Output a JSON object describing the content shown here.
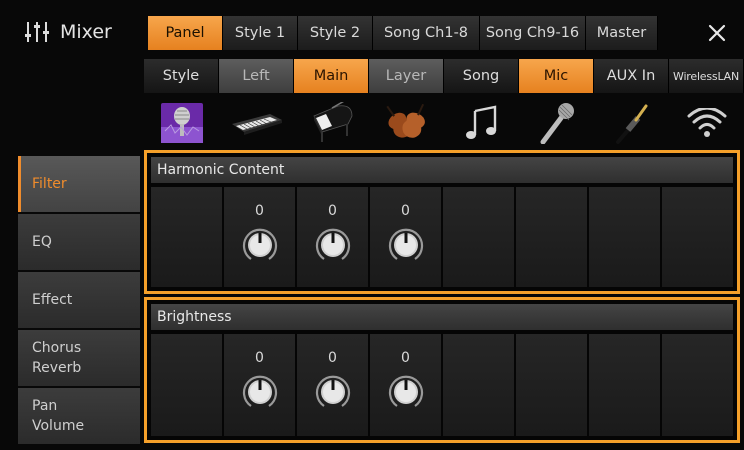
{
  "header": {
    "title": "Mixer",
    "tabs": [
      "Panel",
      "Style 1",
      "Style 2",
      "Song Ch1-8",
      "Song Ch9-16",
      "Master"
    ],
    "active_tab": "Panel",
    "close_icon": "close-icon"
  },
  "parts": [
    {
      "label": "Style",
      "state": "normal",
      "icon": "microphone-stage-icon"
    },
    {
      "label": "Left",
      "state": "inactive",
      "icon": "keyboard-icon"
    },
    {
      "label": "Main",
      "state": "selected",
      "icon": "grand-piano-icon"
    },
    {
      "label": "Layer",
      "state": "inactive",
      "icon": "violins-icon"
    },
    {
      "label": "Song",
      "state": "normal",
      "icon": "music-note-icon"
    },
    {
      "label": "Mic",
      "state": "selected",
      "icon": "microphone-icon"
    },
    {
      "label": "AUX In",
      "state": "normal",
      "icon": "audio-plug-icon"
    },
    {
      "label": "WirelessLAN",
      "state": "normal",
      "icon": "wifi-icon"
    }
  ],
  "side_menu": [
    {
      "label": "Filter",
      "active": true
    },
    {
      "label": "EQ",
      "active": false
    },
    {
      "label": "Effect",
      "active": false
    },
    {
      "label": "Chorus\nReverb",
      "active": false
    },
    {
      "label": "Pan\nVolume",
      "active": false
    }
  ],
  "harmonic": {
    "label": "Harmonic Content",
    "values": [
      "0",
      "0",
      "0"
    ]
  },
  "brightness": {
    "label": "Brightness",
    "values": [
      "0",
      "0",
      "0"
    ]
  },
  "colors": {
    "accent": "#f08c2c",
    "panel_border": "#f5a02a",
    "background": "#080808"
  }
}
